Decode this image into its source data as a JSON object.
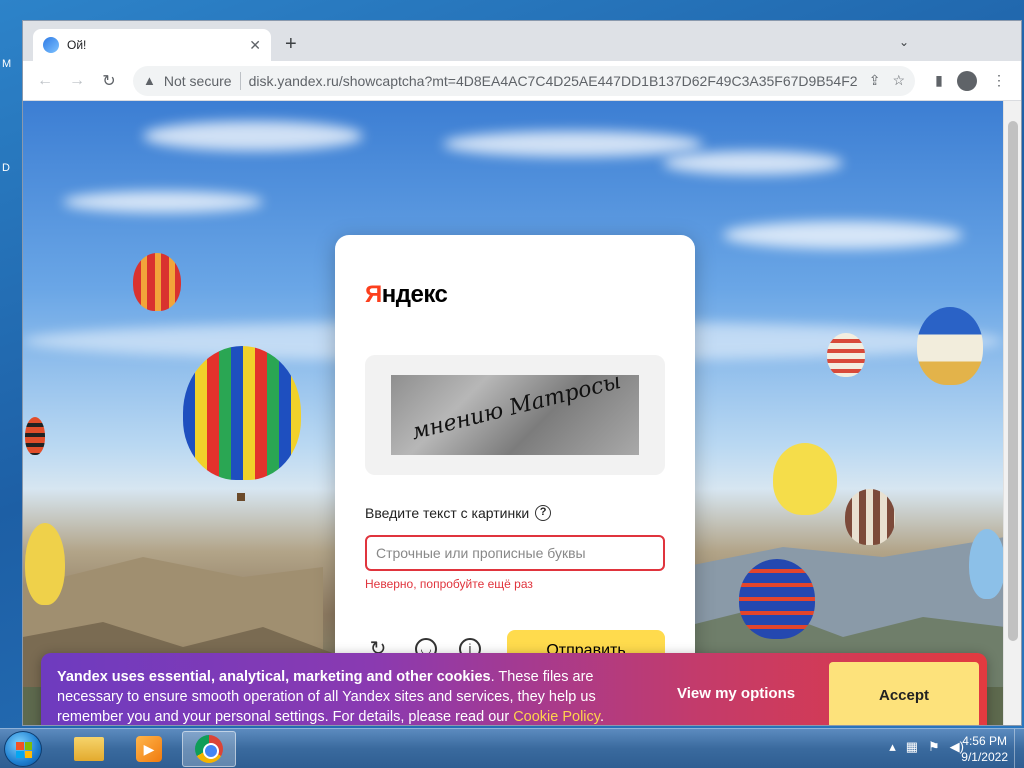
{
  "desktop": {
    "glyph_left_1": "M",
    "glyph_left_2": "D"
  },
  "browser": {
    "tab_title": "Ой!",
    "tab_close": "✕",
    "new_tab": "+",
    "tab_search": "⌄",
    "nav": {
      "back": "←",
      "forward": "→",
      "reload": "↻"
    },
    "security_label": "Not secure",
    "url": "disk.yandex.ru/showcaptcha?mt=4D8EA4AC7C4D25AE447DD1B137D62F49C3A35F67D9B54F2...",
    "window_controls": {
      "minimize": "—",
      "restore": "❐",
      "close": "✕"
    }
  },
  "captcha": {
    "logo": "Яндекс",
    "captcha_text": "мнению Матросы",
    "prompt": "Введите текст с картинки",
    "help": "?",
    "input_value": "",
    "input_placeholder": "Строчные или прописные буквы",
    "error": "Неверно, попробуйте ещё раз",
    "submit": "Отправить",
    "icon_refresh": "↻",
    "icon_audio": "◡",
    "icon_info": "i"
  },
  "cookie_banner": {
    "bold_text": "Yandex uses essential, analytical, marketing and other cookies",
    "text": ". These files are necessary to ensure smooth operation of all Yandex sites and services, they help us remember you and your personal settings. For details, please read our ",
    "link": "Cookie Policy",
    "end": ".",
    "view_options": "View my options",
    "accept": "Accept"
  },
  "taskbar": {
    "clock_time": "4:56 PM",
    "clock_date": "9/1/2022"
  },
  "colors": {
    "yandex_red": "#fc3f1d",
    "error_red": "#e0343d",
    "submit_yellow": "#ffdb4d",
    "accept_yellow": "#fde27b",
    "cookie_link": "#ffd24d"
  }
}
